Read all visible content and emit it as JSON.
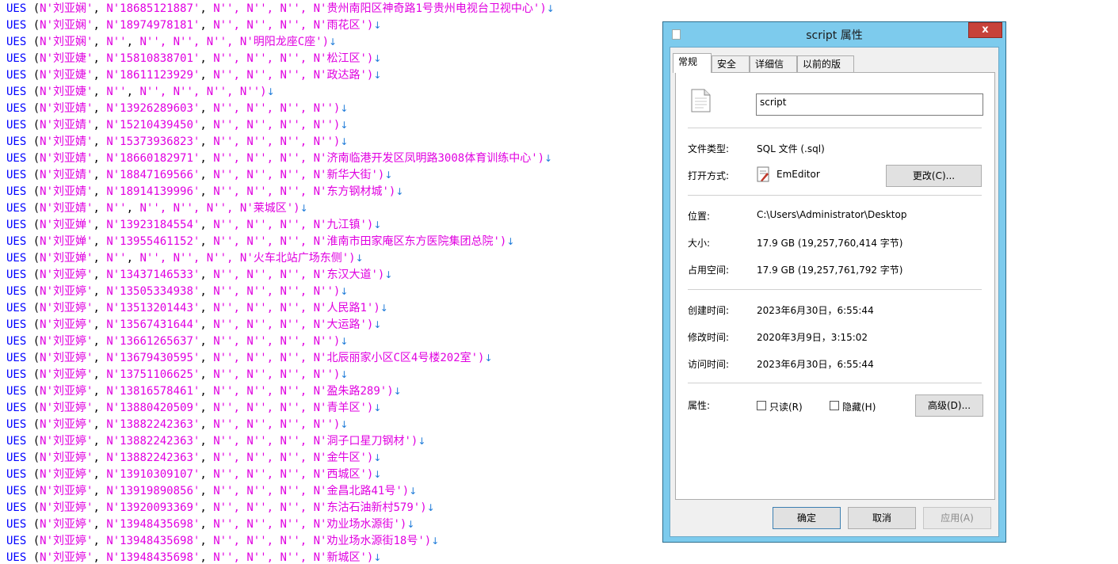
{
  "editor": {
    "lines": [
      {
        "id": "0",
        "name": "N'刘亚娴'",
        "phone": "N'18685121887'",
        "tail": "N'', N'', N'', N'贵州南阳区神奇路1号贵州电视台卫视中心')"
      },
      {
        "id": "1",
        "name": "N'刘亚娴'",
        "phone": "N'18974978181'",
        "tail": "N'', N'', N'', N'雨花区')"
      },
      {
        "id": "2",
        "name": "N'刘亚娴'",
        "phone": "N''",
        "tail": "N'', N'', N'', N'明阳龙座C座')"
      },
      {
        "id": "3",
        "name": "N'刘亚婕'",
        "phone": "N'15810838701'",
        "tail": "N'', N'', N'', N'松江区')"
      },
      {
        "id": "4",
        "name": "N'刘亚婕'",
        "phone": "N'18611123929'",
        "tail": "N'', N'', N'', N'政达路')"
      },
      {
        "id": "5",
        "name": "N'刘亚婕'",
        "phone": "N''",
        "tail": "N'', N'', N'', N'')"
      },
      {
        "id": "6",
        "name": "N'刘亚婧'",
        "phone": "N'13926289603'",
        "tail": "N'', N'', N'', N'')"
      },
      {
        "id": "7",
        "name": "N'刘亚婧'",
        "phone": "N'15210439450'",
        "tail": "N'', N'', N'', N'')"
      },
      {
        "id": "8",
        "name": "N'刘亚婧'",
        "phone": "N'15373936823'",
        "tail": "N'', N'', N'', N'')"
      },
      {
        "id": "9",
        "name": "N'刘亚婧'",
        "phone": "N'18660182971'",
        "tail": "N'', N'', N'', N'济南临港开发区凤明路3008体育训练中心')"
      },
      {
        "id": "10",
        "name": "N'刘亚婧'",
        "phone": "N'18847169566'",
        "tail": "N'', N'', N'', N'新华大街')"
      },
      {
        "id": "11",
        "name": "N'刘亚婧'",
        "phone": "N'18914139996'",
        "tail": "N'', N'', N'', N'东方钢材城')"
      },
      {
        "id": "12",
        "name": "N'刘亚婧'",
        "phone": "N''",
        "tail": "N'', N'', N'', N'莱城区')"
      },
      {
        "id": "13",
        "name": "N'刘亚婵'",
        "phone": "N'13923184554'",
        "tail": "N'', N'', N'', N'九江镇')"
      },
      {
        "id": "14",
        "name": "N'刘亚婵'",
        "phone": "N'13955461152'",
        "tail": "N'', N'', N'', N'淮南市田家庵区东方医院集团总院')"
      },
      {
        "id": "15",
        "name": "N'刘亚婵'",
        "phone": "N''",
        "tail": "N'', N'', N'', N'火车北站广场东侧')"
      },
      {
        "id": "16",
        "name": "N'刘亚婷'",
        "phone": "N'13437146533'",
        "tail": "N'', N'', N'', N'东汉大道')"
      },
      {
        "id": "17",
        "name": "N'刘亚婷'",
        "phone": "N'13505334938'",
        "tail": "N'', N'', N'', N'')"
      },
      {
        "id": "18",
        "name": "N'刘亚婷'",
        "phone": "N'13513201443'",
        "tail": "N'', N'', N'', N'人民路1')"
      },
      {
        "id": "19",
        "name": "N'刘亚婷'",
        "phone": "N'13567431644'",
        "tail": "N'', N'', N'', N'大运路')"
      },
      {
        "id": "20",
        "name": "N'刘亚婷'",
        "phone": "N'13661265637'",
        "tail": "N'', N'', N'', N'')"
      },
      {
        "id": "21",
        "name": "N'刘亚婷'",
        "phone": "N'13679430595'",
        "tail": "N'', N'', N'', N'北辰丽家小区C区4号楼202室')"
      },
      {
        "id": "22",
        "name": "N'刘亚婷'",
        "phone": "N'13751106625'",
        "tail": "N'', N'', N'', N'')"
      },
      {
        "id": "23",
        "name": "N'刘亚婷'",
        "phone": "N'13816578461'",
        "tail": "N'', N'', N'', N'盈朱路289')"
      },
      {
        "id": "24",
        "name": "N'刘亚婷'",
        "phone": "N'13880420509'",
        "tail": "N'', N'', N'', N'青羊区')"
      },
      {
        "id": "25",
        "name": "N'刘亚婷'",
        "phone": "N'13882242363'",
        "tail": "N'', N'', N'', N'')"
      },
      {
        "id": "26",
        "name": "N'刘亚婷'",
        "phone": "N'13882242363'",
        "tail": "N'', N'', N'', N'洞子口星刀钢材')"
      },
      {
        "id": "27",
        "name": "N'刘亚婷'",
        "phone": "N'13882242363'",
        "tail": "N'', N'', N'', N'金牛区')"
      },
      {
        "id": "28",
        "name": "N'刘亚婷'",
        "phone": "N'13910309107'",
        "tail": "N'', N'', N'', N'西城区')"
      },
      {
        "id": "29",
        "name": "N'刘亚婷'",
        "phone": "N'13919890856'",
        "tail": "N'', N'', N'', N'金昌北路41号')"
      },
      {
        "id": "30",
        "name": "N'刘亚婷'",
        "phone": "N'13920093369'",
        "tail": "N'', N'', N'', N'东沽石油新村579')"
      },
      {
        "id": "31",
        "name": "N'刘亚婷'",
        "phone": "N'13948435698'",
        "tail": "N'', N'', N'', N'劝业场水源街')"
      },
      {
        "id": "32",
        "name": "N'刘亚婷'",
        "phone": "N'13948435698'",
        "tail": "N'', N'', N'', N'劝业场水源街18号')"
      },
      {
        "id": "33",
        "name": "N'刘亚婷'",
        "phone": "N'13948435698'",
        "tail": "N'', N'', N'', N'新城区')"
      }
    ],
    "keyword": "UES",
    "newline_glyph": "↓",
    "colors": {
      "keyword": "#0000ff",
      "string": "#e000e0",
      "newline": "#1e7bd9"
    }
  },
  "dialog": {
    "title": "script 属性",
    "close_glyph": "x",
    "tabs": [
      "常规",
      "安全",
      "详细信息",
      "以前的版本"
    ],
    "active_tab": "常规",
    "file_name": "script",
    "rows": {
      "type_label": "文件类型:",
      "type_value": "SQL 文件 (.sql)",
      "open_label": "打开方式:",
      "open_value": "EmEditor",
      "change_button": "更改(C)...",
      "location_label": "位置:",
      "location_value": "C:\\Users\\Administrator\\Desktop",
      "size_label": "大小:",
      "size_value": "17.9 GB (19,257,760,414 字节)",
      "disk_label": "占用空间:",
      "disk_value": "17.9 GB (19,257,761,792 字节)",
      "created_label": "创建时间:",
      "created_value": "2023年6月30日，6:55:44",
      "modified_label": "修改时间:",
      "modified_value": "2020年3月9日，3:15:02",
      "accessed_label": "访问时间:",
      "accessed_value": "2023年6月30日，6:55:44",
      "attr_label": "属性:",
      "readonly_label": "只读(R)",
      "readonly_checked": false,
      "hidden_label": "隐藏(H)",
      "hidden_checked": false,
      "advanced_button": "高级(D)..."
    },
    "footer": {
      "ok": "确定",
      "cancel": "取消",
      "apply": "应用(A)"
    },
    "colors": {
      "frame": "#7dcbed",
      "close": "#c7423a"
    }
  }
}
